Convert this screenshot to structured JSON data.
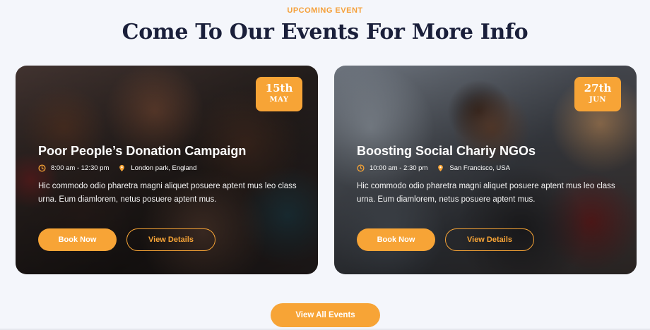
{
  "section": {
    "eyebrow": "UPCOMING EVENT",
    "heading": "Come To Our Events For More Info"
  },
  "colors": {
    "accent": "#f7a436",
    "heading": "#1a1f3a",
    "background": "#f4f6fb"
  },
  "events": [
    {
      "date_day": "15th",
      "date_month": "MAY",
      "title": "Poor People’s Donation Campaign",
      "time": "8:00 am - 12:30 pm",
      "location": "London park, England",
      "description": "Hic commodo odio pharetra magni aliquet posuere aptent mus leo class urna. Eum diamlorem, netus posuere aptent mus.",
      "book_label": "Book Now",
      "details_label": "View Details"
    },
    {
      "date_day": "27th",
      "date_month": "JUN",
      "title": "Boosting Social Chariy NGOs",
      "time": "10:00 am - 2:30 pm",
      "location": "San Francisco, USA",
      "description": "Hic commodo odio pharetra magni aliquet posuere aptent mus leo class urna. Eum diamlorem, netus posuere aptent mus.",
      "book_label": "Book Now",
      "details_label": "View Details"
    }
  ],
  "footer": {
    "view_all_label": "View All Events"
  },
  "icons": {
    "time": "clock-icon",
    "location": "map-pin-icon"
  }
}
